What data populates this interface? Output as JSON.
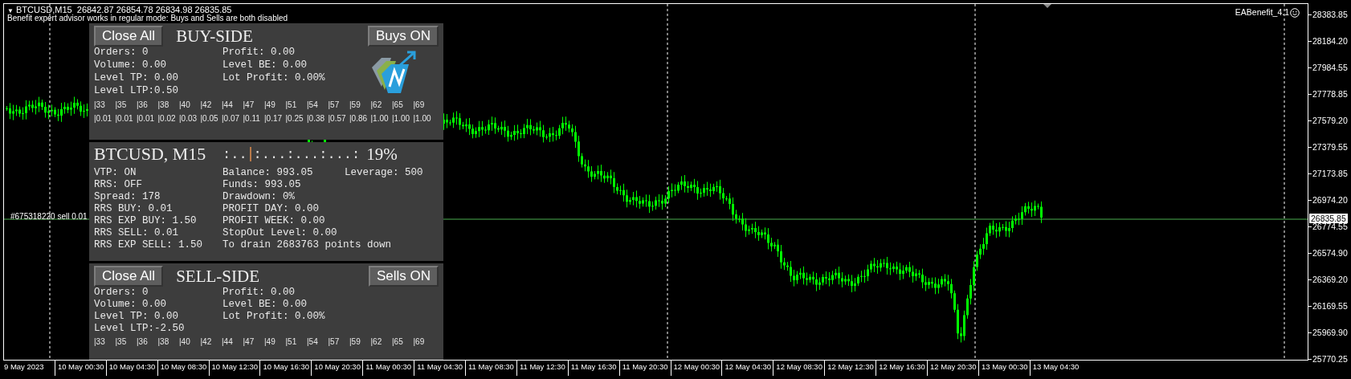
{
  "header": {
    "menu_glyph": "▼",
    "symbol_line": "BTCUSD,M15  26842.87 26854.78 26834.98 26835.85",
    "notice": "Benefit expert advisor works in regular mode: Buys and Sells are both disabled"
  },
  "expert": {
    "name": "EABenefit_4.1"
  },
  "buy_panel": {
    "close_button": "Close All",
    "title": "BUY-SIDE",
    "toggle_button": "Buys ON",
    "stats_left": [
      "Orders: 0",
      "Volume: 0.00",
      "Level TP: 0.00",
      "Level LTP:0.50"
    ],
    "stats_right": [
      "Profit: 0.00",
      "Level BE: 0.00",
      "Lot Profit: 0.00%"
    ],
    "levels": [
      "|33",
      "|35",
      "|36",
      "|38",
      "|40",
      "|42",
      "|44",
      "|47",
      "|49",
      "|51",
      "|54",
      "|57",
      "|59",
      "|62",
      "|65",
      "|69"
    ],
    "lots": [
      "|0.01",
      "|0.01",
      "|0.01",
      "|0.02",
      "|0.03",
      "|0.05",
      "|0.07",
      "|0.11",
      "|0.17",
      "|0.25",
      "|0.38",
      "|0.57",
      "|0.86",
      "|1.00",
      "|1.00",
      "|1.00"
    ]
  },
  "info_panel": {
    "title": "BTCUSD, M15",
    "progress_left": ":..",
    "progress_right": ":...:...:...:",
    "percent": "19%",
    "stats_left": [
      "VTP: ON",
      "RRS: OFF",
      "Spread: 178",
      "RRS BUY: 0.01",
      "RRS EXP BUY: 1.50",
      "RRS SELL: 0.01",
      "RRS EXP SELL: 1.50"
    ],
    "stats_middle": [
      "Balance: 993.05",
      "Funds: 993.05",
      "Drawdown: 0%",
      "PROFIT DAY: 0.00",
      "PROFIT WEEK: 0.00",
      "StopOut Level: 0.00",
      "To drain 2683763 points down"
    ],
    "stats_right": [
      "Leverage: 500"
    ]
  },
  "sell_panel": {
    "close_button": "Close All",
    "title": "SELL-SIDE",
    "toggle_button": "Sells ON",
    "stats_left": [
      "Orders: 0",
      "Volume: 0.00",
      "Level TP: 0.00",
      "Level LTP:-2.50"
    ],
    "stats_right": [
      "Profit: 0.00",
      "Level BE: 0.00",
      "Lot Profit: 0.00%"
    ],
    "levels": [
      "|33",
      "|35",
      "|36",
      "|38",
      "|40",
      "|42",
      "|44",
      "|47",
      "|49",
      "|51",
      "|54",
      "|57",
      "|59",
      "|62",
      "|65",
      "|69"
    ]
  },
  "order_line": {
    "label": "#675318220 sell 0.01",
    "price": "26835.85"
  },
  "price_axis": [
    "28383.85",
    "28184.20",
    "27984.55",
    "27778.85",
    "27579.20",
    "27379.55",
    "27173.85",
    "26974.20",
    "26774.55",
    "26574.90",
    "26369.20",
    "26169.55",
    "25969.90",
    "25770.25"
  ],
  "time_axis": [
    "9 May 2023",
    "10 May 00:30",
    "10 May 04:30",
    "10 May 08:30",
    "10 May 12:30",
    "10 May 16:30",
    "10 May 20:30",
    "11 May 00:30",
    "11 May 04:30",
    "11 May 08:30",
    "11 May 12:30",
    "11 May 16:30",
    "11 May 20:30",
    "12 May 00:30",
    "12 May 04:30",
    "12 May 08:30",
    "12 May 12:30",
    "12 May 16:30",
    "12 May 20:30",
    "13 May 00:30",
    "13 May 04:30"
  ]
}
